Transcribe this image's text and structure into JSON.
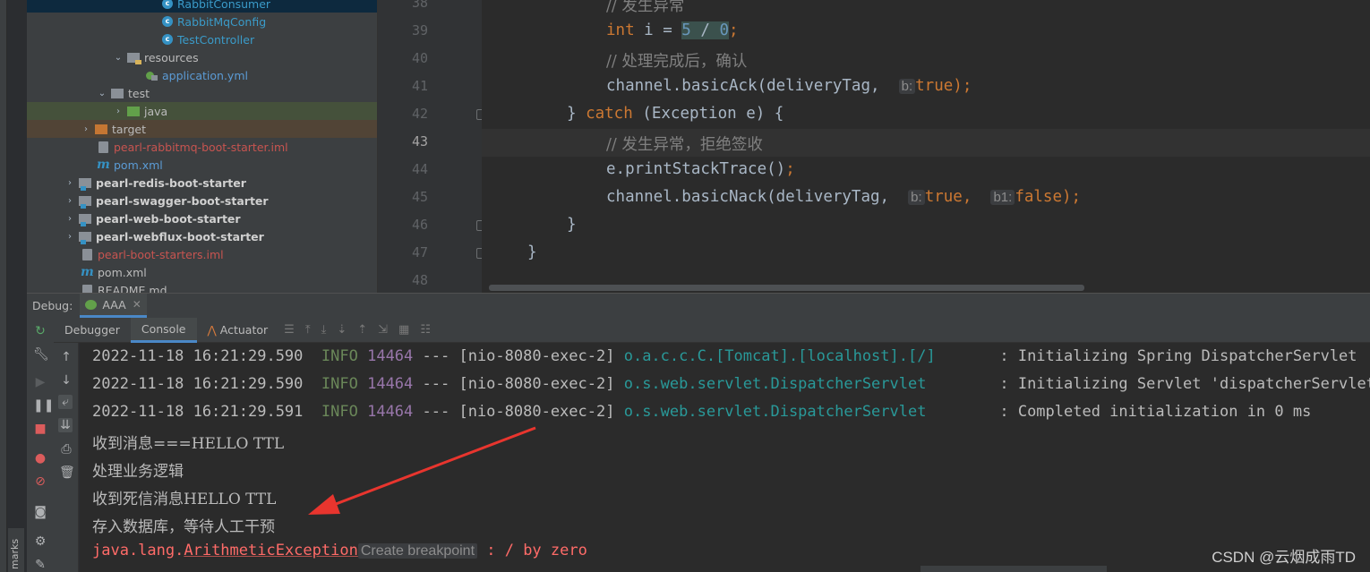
{
  "sidebar": {
    "bookmarks_label": "marks"
  },
  "tree": {
    "items": [
      {
        "label": "RabbitConsumer",
        "icon": "class-icon"
      },
      {
        "label": "RabbitMqConfig",
        "icon": "class-icon"
      },
      {
        "label": "TestController",
        "icon": "class-icon"
      },
      {
        "label": "resources",
        "icon": "resources-folder-icon"
      },
      {
        "label": "application.yml",
        "icon": "spring-yml-icon"
      },
      {
        "label": "test",
        "icon": "folder-icon"
      },
      {
        "label": "java",
        "icon": "green-folder-icon"
      },
      {
        "label": "target",
        "icon": "orange-folder-icon"
      },
      {
        "label": "pearl-rabbitmq-boot-starter.iml",
        "icon": "iml-file-icon"
      },
      {
        "label": "pom.xml",
        "icon": "maven-icon"
      },
      {
        "label": "pearl-redis-boot-starter",
        "icon": "module-icon"
      },
      {
        "label": "pearl-swagger-boot-starter",
        "icon": "module-icon"
      },
      {
        "label": "pearl-web-boot-starter",
        "icon": "module-icon"
      },
      {
        "label": "pearl-webflux-boot-starter",
        "icon": "module-icon"
      },
      {
        "label": "pearl-boot-starters.iml",
        "icon": "iml-file-icon"
      },
      {
        "label": "pom.xml",
        "icon": "maven-icon"
      },
      {
        "label": "README.md",
        "icon": "markdown-icon"
      }
    ]
  },
  "editor": {
    "line_numbers": [
      "38",
      "39",
      "40",
      "41",
      "42",
      "43",
      "44",
      "45",
      "46",
      "47",
      "48"
    ],
    "current_line": "43",
    "code": {
      "l38_comment": "// 发生异常",
      "l39_kw": "int",
      "l39_var": " i = ",
      "l39_n1": "5",
      "l39_op": " / ",
      "l39_n2": "0",
      "l39_end": ";",
      "l40_comment": "// 处理完成后，确认",
      "l41_call": "channel.basicAck(deliveryTag, ",
      "l41_hint": "b:",
      "l41_val": "true",
      "l41_end": ");",
      "l42_brace": "} ",
      "l42_kw": "catch",
      "l42_rest": " (Exception e) {",
      "l43_comment": "// 发生异常，拒绝签收",
      "l44_call": "e.printStackTrace()",
      "l44_end": ";",
      "l45_call": "channel.basicNack(deliveryTag, ",
      "l45_hint1": "b:",
      "l45_val1": "true",
      "l45_sep": ", ",
      "l45_hint2": "b1:",
      "l45_val2": "false",
      "l45_end": ");",
      "l46_brace": "}",
      "l47_brace": "}"
    }
  },
  "debug": {
    "label": "Debug:",
    "run_config": "AAA",
    "tabs": [
      "Debugger",
      "Console",
      "Actuator"
    ],
    "active_tab": "Console"
  },
  "console": {
    "lines": [
      {
        "ts": "2022-11-18 16:21:29.590",
        "level": "INFO",
        "pid": "14464",
        "sep": " --- ",
        "thread": "[nio-8080-exec-2]",
        "logger": "o.a.c.c.C.[Tomcat].[localhost].[/]      ",
        "msg": " : Initializing Spring DispatcherServlet 'dispatcherServlet'"
      },
      {
        "ts": "2022-11-18 16:21:29.590",
        "level": "INFO",
        "pid": "14464",
        "sep": " --- ",
        "thread": "[nio-8080-exec-2]",
        "logger": "o.s.web.servlet.DispatcherServlet       ",
        "msg": " : Initializing Servlet 'dispatcherServlet'"
      },
      {
        "ts": "2022-11-18 16:21:29.591",
        "level": "INFO",
        "pid": "14464",
        "sep": " --- ",
        "thread": "[nio-8080-exec-2]",
        "logger": "o.s.web.servlet.DispatcherServlet       ",
        "msg": " : Completed initialization in 0 ms"
      }
    ],
    "out1": "收到消息===HELLO TTL",
    "out2": "处理业务逻辑",
    "out3": "收到死信消息HELLO TTL",
    "out4": "存入数据库，等待人工干预",
    "err_prefix": "java.lang.",
    "err_class": "ArithmeticException",
    "err_breakpoint": "Create breakpoint",
    "err_msg": " : / by zero"
  },
  "watermark": "CSDN @云烟成雨TD",
  "colors": {
    "annotation_arrow": "#e8352e",
    "accent_tab": "#4a88c7"
  }
}
